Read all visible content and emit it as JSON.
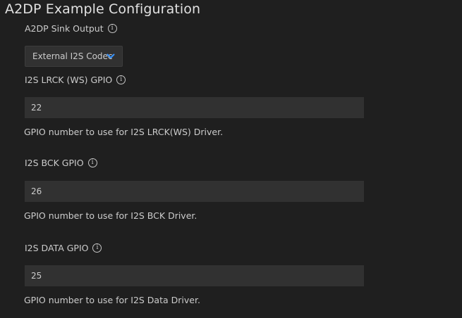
{
  "title": "A2DP Example Configuration",
  "sink_output": {
    "label": "A2DP Sink Output",
    "selected": "External I2S Codec"
  },
  "lrck": {
    "label": "I2S LRCK (WS) GPIO",
    "value": "22",
    "description": "GPIO number to use for I2S LRCK(WS) Driver."
  },
  "bck": {
    "label": "I2S BCK GPIO",
    "value": "26",
    "description": "GPIO number to use for I2S BCK Driver."
  },
  "data": {
    "label": "I2S DATA GPIO",
    "value": "25",
    "description": "GPIO number to use for I2S Data Driver."
  },
  "icons": {
    "info": "info-icon",
    "chevron": "chevron-down-icon"
  },
  "colors": {
    "background": "#1f1f1f",
    "input_bg": "#313131",
    "chevron": "#3794ff"
  }
}
